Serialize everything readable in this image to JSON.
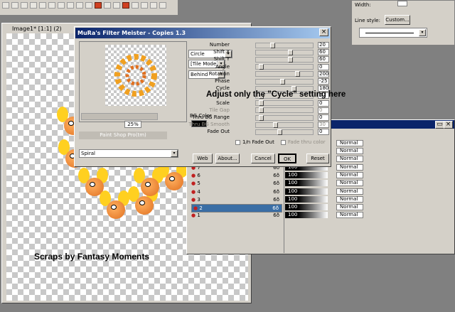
{
  "document": {
    "title": "Image1* [1:1] (2)",
    "watermark": "Scraps by Fantasy Moments"
  },
  "line_style_panel": {
    "width_label": "Width:",
    "line_style_label": "Line style:",
    "custom_button": "Custom..."
  },
  "dialog": {
    "title": "MuRa's Filter Meister - Copies 1.3",
    "zoom": "25%",
    "preview_label": "Paint Shop Pro(tm)",
    "preset": "Spiral",
    "shape_select": "Circle",
    "tile_select": "[Tile Mode]",
    "order_select": "Behind",
    "bg_color_label": "BG Color",
    "bg_color": "#000000",
    "params": [
      {
        "label": "Number",
        "value": "20",
        "level": 0.24,
        "disabled": false
      },
      {
        "label": "Shift X",
        "value": "60",
        "level": 0.62,
        "disabled": false
      },
      {
        "label": "Shift Y",
        "value": "60",
        "level": 0.62,
        "disabled": false
      },
      {
        "label": "Angle",
        "value": "0",
        "level": 0.0,
        "disabled": false
      },
      {
        "label": "Rotation",
        "value": "200",
        "level": 0.78,
        "disabled": false
      },
      {
        "label": "Phase",
        "value": "-25",
        "level": 0.45,
        "disabled": false
      },
      {
        "label": "Cycle",
        "value": "180",
        "level": 0.7,
        "disabled": false
      },
      {
        "label": "",
        "value": "0",
        "level": 0.0,
        "disabled": false
      },
      {
        "label": "Scale",
        "value": "0",
        "level": 0.0,
        "disabled": false
      },
      {
        "label": "Tile Gap",
        "value": "0",
        "level": 0.0,
        "disabled": true
      },
      {
        "label": "Thru BG Range",
        "value": "0",
        "level": 0.0,
        "disabled": false
      },
      {
        "label": "Thru BG Smooth",
        "value": "30",
        "level": 0.3,
        "disabled": true
      },
      {
        "label": "Fade Out",
        "value": "0",
        "level": 0.4,
        "disabled": false
      }
    ],
    "fade_check": "1/n Fade Out",
    "fade_check2": "Fade thru color",
    "buttons": {
      "web": "Web",
      "about": "About...",
      "cancel": "Cancel",
      "ok": "OK",
      "reset": "Reset"
    }
  },
  "instruction": "Adjust only the \"Cycle\" setting here",
  "layers": {
    "rows": [
      {
        "name": "7",
        "opacity": "100",
        "blend": "Normal",
        "selected": false
      },
      {
        "name": "6",
        "opacity": "100",
        "blend": "Normal",
        "selected": false
      },
      {
        "name": "5",
        "opacity": "100",
        "blend": "Normal",
        "selected": false
      },
      {
        "name": "4",
        "opacity": "100",
        "blend": "Normal",
        "selected": false
      },
      {
        "name": "3",
        "opacity": "100",
        "blend": "Normal",
        "selected": false
      },
      {
        "name": "2",
        "opacity": "100",
        "blend": "Normal",
        "selected": true
      },
      {
        "name": "1",
        "opacity": "100",
        "blend": "Normal",
        "selected": false
      }
    ],
    "top_blends": [
      "Normal",
      "Normal",
      "Normal"
    ]
  },
  "colors": {
    "title_bar": "#0a246a",
    "window_bg": "#d4d0c8",
    "desktop": "#808080",
    "selection": "#3a6ea5"
  }
}
